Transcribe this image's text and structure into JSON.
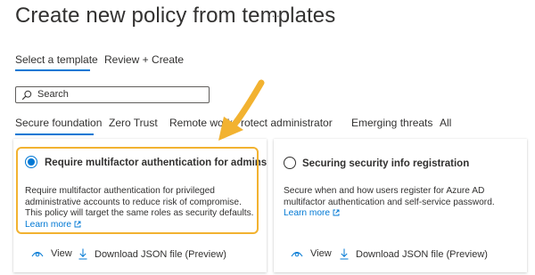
{
  "page": {
    "title": "Create new policy from templates",
    "more_label": "···"
  },
  "steps": [
    {
      "label": "Select a template",
      "selected": true
    },
    {
      "label": "Review + Create",
      "selected": false
    }
  ],
  "search": {
    "placeholder": "Search"
  },
  "tabs": [
    {
      "label": "Secure foundation",
      "selected": true
    },
    {
      "label": "Zero Trust"
    },
    {
      "label": "Remote work"
    },
    {
      "label": "Protect administrator"
    },
    {
      "label": "Emerging threats"
    },
    {
      "label": "All"
    }
  ],
  "cards": [
    {
      "title": "Require multifactor authentication for admins",
      "selected": true,
      "description": "Require multifactor authentication for privileged administrative accounts to reduce risk of compromise. This policy will target the same roles as security defaults.",
      "learn_more": "Learn more",
      "view_label": "View",
      "download_label": "Download JSON file (Preview)"
    },
    {
      "title": "Securing security info registration",
      "selected": false,
      "description": "Secure when and how users register for Azure AD multifactor authentication and self-service password.",
      "learn_more": "Learn more",
      "view_label": "View",
      "download_label": "Download JSON file (Preview)"
    }
  ],
  "colors": {
    "accent": "#0078d4",
    "highlight": "#f2b230",
    "arrow": "#f2b230"
  },
  "icons": {
    "search": "search-icon",
    "view": "eye-icon",
    "download": "download-icon",
    "external": "external-link-icon"
  }
}
